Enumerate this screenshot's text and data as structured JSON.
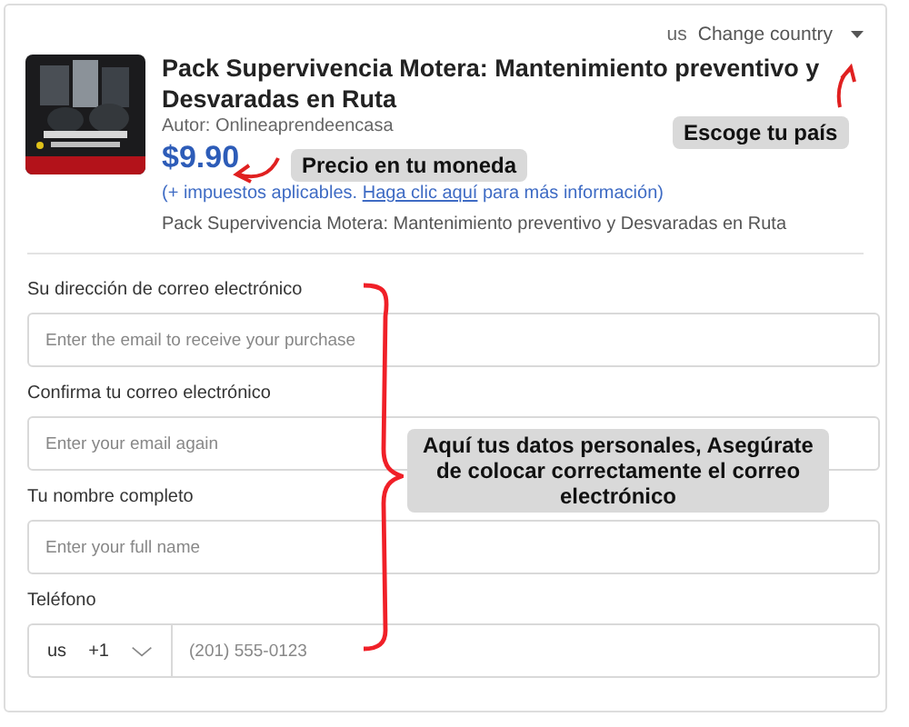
{
  "country": {
    "code": "us",
    "label": "Change country"
  },
  "product": {
    "title": "Pack Supervivencia Motera: Mantenimiento preventivo y Desvaradas en Ruta",
    "author": "Autor: Onlineaprendeencasa",
    "price": "$9.90",
    "tax_note": {
      "before": "(+ impuestos aplicables. ",
      "link": "Haga clic aquí",
      "after": " para más información)"
    },
    "description": "Pack Supervivencia Motera: Mantenimiento preventivo y Desvaradas en Ruta"
  },
  "fields": [
    {
      "kind": "text",
      "label": "Su dirección de correo electrónico",
      "placeholder": "Enter the email to receive your purchase"
    },
    {
      "kind": "text",
      "label": "Confirma tu correo electrónico",
      "placeholder": "Enter your email again"
    },
    {
      "kind": "text",
      "label": "Tu nombre completo",
      "placeholder": "Enter your full name"
    },
    {
      "kind": "phone",
      "label": "Teléfono",
      "country": "us",
      "dial_code": "+1",
      "placeholder": "(201) 555-0123"
    }
  ],
  "annotations": [
    {
      "kind": "country",
      "text": "Escoge tu país"
    },
    {
      "kind": "price",
      "text": "Precio en tu moneda"
    },
    {
      "kind": "form",
      "text": "Aquí tus datos personales, Asegúrate de colocar correctamente el correo electrónico"
    }
  ]
}
